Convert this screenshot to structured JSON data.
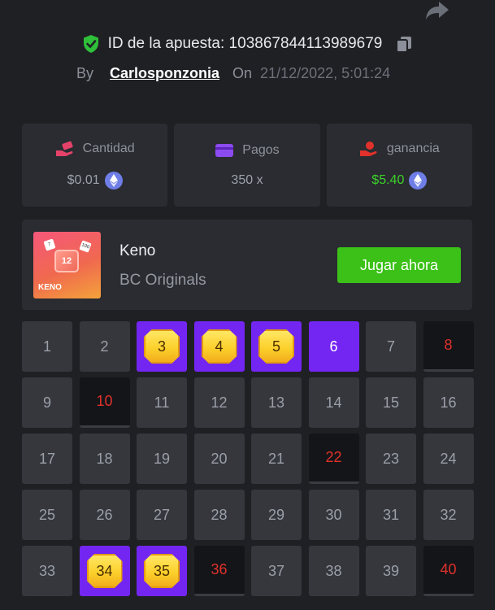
{
  "header": {
    "bet_id_label": "ID de la apuesta: 103867844113989679",
    "by_label": "By",
    "username": "Carlosponzonia",
    "on_label": "On",
    "datetime": "21/12/2022, 5:01:24"
  },
  "stats": [
    {
      "label": "Cantidad",
      "value": "$0.01",
      "icon": "money-hand-icon",
      "color": "#e5426a"
    },
    {
      "label": "Pagos",
      "value": "350 x",
      "icon": "card-icon",
      "color": "#8c4bf0"
    },
    {
      "label": "ganancia",
      "value": "$5.40",
      "icon": "coin-hand-icon",
      "color": "#e0312c"
    }
  ],
  "game": {
    "name": "Keno",
    "provider": "BC Originals",
    "play_label": "Jugar ahora",
    "thumb_label": "KENO",
    "thumb_number": "12",
    "thumb_die_numbers": [
      "7",
      "100"
    ]
  },
  "colors": {
    "accent_green": "#3bc117",
    "selected_purple": "#7326f2",
    "miss_red": "#e0312c",
    "win_green": "#3cd12a",
    "gold": "#fcd02b"
  },
  "grid": {
    "cells": [
      {
        "n": "1",
        "state": "normal"
      },
      {
        "n": "2",
        "state": "normal"
      },
      {
        "n": "3",
        "state": "hit"
      },
      {
        "n": "4",
        "state": "hit"
      },
      {
        "n": "5",
        "state": "hit"
      },
      {
        "n": "6",
        "state": "selected"
      },
      {
        "n": "7",
        "state": "normal"
      },
      {
        "n": "8",
        "state": "miss"
      },
      {
        "n": "9",
        "state": "normal"
      },
      {
        "n": "10",
        "state": "miss"
      },
      {
        "n": "11",
        "state": "normal"
      },
      {
        "n": "12",
        "state": "normal"
      },
      {
        "n": "13",
        "state": "normal"
      },
      {
        "n": "14",
        "state": "normal"
      },
      {
        "n": "15",
        "state": "normal"
      },
      {
        "n": "16",
        "state": "normal"
      },
      {
        "n": "17",
        "state": "normal"
      },
      {
        "n": "18",
        "state": "normal"
      },
      {
        "n": "19",
        "state": "normal"
      },
      {
        "n": "20",
        "state": "normal"
      },
      {
        "n": "21",
        "state": "normal"
      },
      {
        "n": "22",
        "state": "miss"
      },
      {
        "n": "23",
        "state": "normal"
      },
      {
        "n": "24",
        "state": "normal"
      },
      {
        "n": "25",
        "state": "normal"
      },
      {
        "n": "26",
        "state": "normal"
      },
      {
        "n": "27",
        "state": "normal"
      },
      {
        "n": "28",
        "state": "normal"
      },
      {
        "n": "29",
        "state": "normal"
      },
      {
        "n": "30",
        "state": "normal"
      },
      {
        "n": "31",
        "state": "normal"
      },
      {
        "n": "32",
        "state": "normal"
      },
      {
        "n": "33",
        "state": "normal"
      },
      {
        "n": "34",
        "state": "hit"
      },
      {
        "n": "35",
        "state": "hit"
      },
      {
        "n": "36",
        "state": "miss"
      },
      {
        "n": "37",
        "state": "normal"
      },
      {
        "n": "38",
        "state": "normal"
      },
      {
        "n": "39",
        "state": "normal"
      },
      {
        "n": "40",
        "state": "miss"
      }
    ]
  }
}
